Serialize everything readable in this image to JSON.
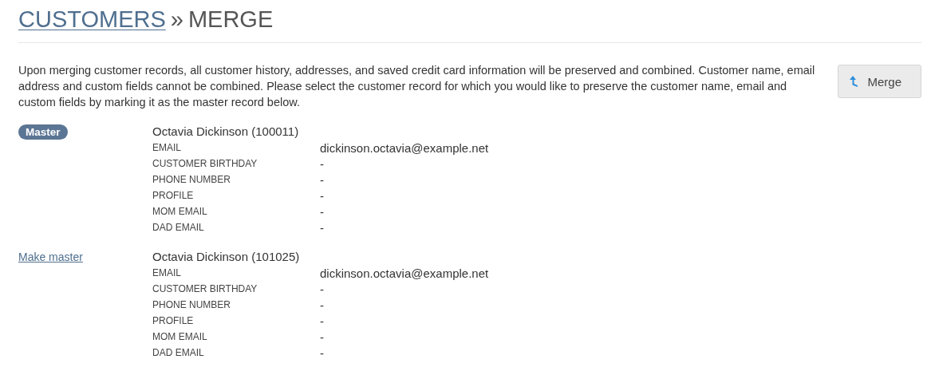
{
  "breadcrumb": {
    "parent": "CUSTOMERS",
    "separator": "»",
    "current": "MERGE"
  },
  "description": "Upon merging customer records, all customer history, addresses, and saved credit card information will be preserved and combined. Customer name, email address and custom fields cannot be combined. Please select the customer record for which you would like to preserve the customer name, email and custom fields by marking it as the master record below.",
  "merge_button": {
    "label": "Merge"
  },
  "records": [
    {
      "selected": true,
      "status_label": "Master",
      "name": "Octavia Dickinson (100011)",
      "fields": [
        {
          "label": "EMAIL",
          "value": "dickinson.octavia@example.net"
        },
        {
          "label": "CUSTOMER BIRTHDAY",
          "value": "-"
        },
        {
          "label": "PHONE NUMBER",
          "value": "-"
        },
        {
          "label": "PROFILE",
          "value": "-"
        },
        {
          "label": "MOM EMAIL",
          "value": "-"
        },
        {
          "label": "DAD EMAIL",
          "value": "-"
        }
      ]
    },
    {
      "selected": false,
      "status_label": "Make master",
      "name": "Octavia Dickinson (101025)",
      "fields": [
        {
          "label": "EMAIL",
          "value": "dickinson.octavia@example.net"
        },
        {
          "label": "CUSTOMER BIRTHDAY",
          "value": "-"
        },
        {
          "label": "PHONE NUMBER",
          "value": "-"
        },
        {
          "label": "PROFILE",
          "value": "-"
        },
        {
          "label": "MOM EMAIL",
          "value": "-"
        },
        {
          "label": "DAD EMAIL",
          "value": "-"
        }
      ]
    }
  ]
}
